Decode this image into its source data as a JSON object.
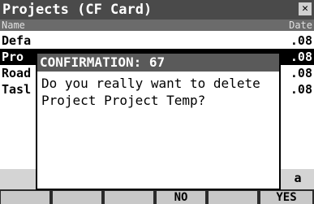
{
  "window": {
    "title": "Projects (CF Card)",
    "close_symbol": "✕"
  },
  "columns": {
    "name": "Name",
    "date": "Date"
  },
  "rows": [
    {
      "name": "Defa",
      "date": ".08"
    },
    {
      "name": "Pro",
      "date": ".08"
    },
    {
      "name": "Road",
      "date": ".08"
    },
    {
      "name": "Tasl",
      "date": ".08"
    }
  ],
  "selected_row": 1,
  "extra_label": "a",
  "fkeys": [
    "",
    "",
    "",
    "NO",
    "",
    "YES"
  ],
  "dialog": {
    "title": "CONFIRMATION: 67",
    "message": "Do you really want to delete\nProject Project Temp?"
  }
}
